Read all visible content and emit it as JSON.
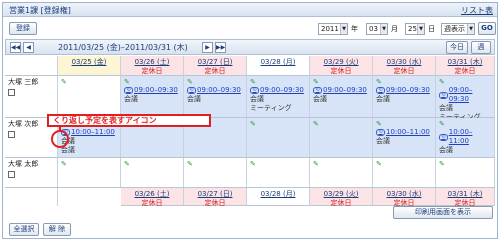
{
  "window": {
    "title": "営業1課 [登録権]",
    "top_link": "リスト表"
  },
  "toolbar": {
    "register_label": "登録",
    "year": "2011",
    "year_unit": "年",
    "month": "03",
    "month_unit": "月",
    "day": "25",
    "day_unit": "日",
    "view_mode": "週表示",
    "go_label": "GO"
  },
  "nav": {
    "buttons": [
      "◀◀",
      "◀"
    ],
    "range": "2011/03/25 (金)–2011/03/31 (木)",
    "next_buttons": [
      "▶",
      "▶▶"
    ],
    "today_label": "今日",
    "week_label": "週"
  },
  "days": [
    {
      "date": "03/25 (金)",
      "note": "",
      "kind": "today"
    },
    {
      "date": "03/26 (土)",
      "note": "定休日",
      "kind": "hol"
    },
    {
      "date": "03/27 (日)",
      "note": "定休日",
      "kind": "hol"
    },
    {
      "date": "03/28 (月)",
      "note": "",
      "kind": "normal"
    },
    {
      "date": "03/29 (火)",
      "note": "定休日",
      "kind": "hol"
    },
    {
      "date": "03/30 (水)",
      "note": "定休日",
      "kind": "hol"
    },
    {
      "date": "03/31 (木)",
      "note": "定休日",
      "kind": "hol"
    }
  ],
  "rows": [
    {
      "name": "大塚 三郎",
      "cells": [
        {
          "time": "",
          "title": "",
          "sub": ""
        },
        {
          "time": "09:00–09:30",
          "title": "会議",
          "sub": ""
        },
        {
          "time": "09:00–09:30",
          "title": "会議",
          "sub": ""
        },
        {
          "time": "09:00–09:30",
          "title": "会議",
          "sub": "ミーティング"
        },
        {
          "time": "09:00–09:30",
          "title": "会議",
          "sub": ""
        },
        {
          "time": "09:00–09:30",
          "title": "会議",
          "sub": ""
        },
        {
          "time": "09:00–09:30",
          "title": "会議",
          "sub": "ミーティング"
        }
      ]
    },
    {
      "name": "大塚 次郎",
      "cells": [
        {
          "time": "10:00–11:00",
          "title": "会議",
          "sub": "会議"
        },
        {
          "time": "",
          "title": "",
          "sub": ""
        },
        {
          "time": "",
          "title": "",
          "sub": ""
        },
        {
          "time": "",
          "title": "",
          "sub": ""
        },
        {
          "time": "",
          "title": "",
          "sub": ""
        },
        {
          "time": "10:00–11:00",
          "title": "会議",
          "sub": ""
        },
        {
          "time": "10:00–11:00",
          "title": "会議",
          "sub": ""
        }
      ]
    },
    {
      "name": "大塚 太郎",
      "cells": []
    }
  ],
  "footer_row": {
    "days": [
      "03/26 (土)",
      "03/27 (日)",
      "03/28 (月)",
      "03/29 (火)",
      "03/30 (水)",
      "03/31 (木)"
    ],
    "notes": [
      "定休日",
      "定休日",
      "",
      "定休日",
      "定休日",
      "定休日"
    ]
  },
  "callout": {
    "text": "くり返し予定を表すアイコン"
  },
  "bottom": {
    "print_label": "印刷用画面を表示",
    "select_all_label": "全選択",
    "deselect_label": "解 除"
  },
  "colors": {
    "holiday_text": "#d02020",
    "accent": "#1b3d7a",
    "callout": "#e02020",
    "schedule_bg": "#d7e4f7"
  }
}
